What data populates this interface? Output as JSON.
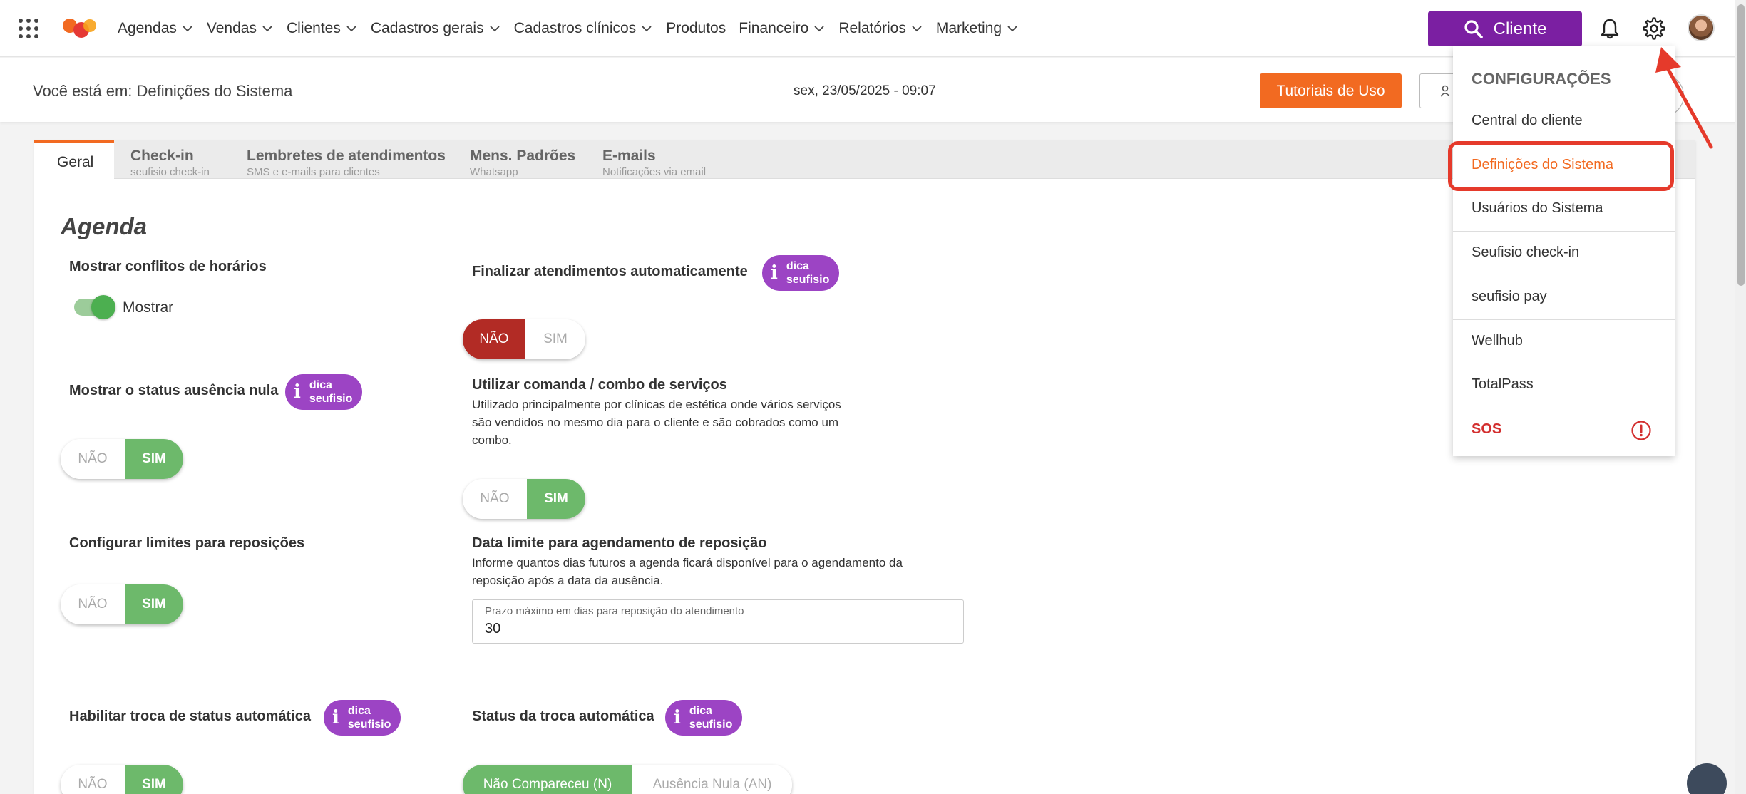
{
  "nav": {
    "items": [
      "Agendas",
      "Vendas",
      "Clientes",
      "Cadastros gerais",
      "Cadastros clínicos",
      "Produtos",
      "Financeiro",
      "Relatórios",
      "Marketing"
    ],
    "cliente_button": "Cliente"
  },
  "subheader": {
    "breadcrumb": "Você está em: Definições do Sistema",
    "datetime": "sex, 23/05/2025 - 09:07",
    "tutorial_button": "Tutoriais de Uso"
  },
  "tabs": [
    {
      "title": "Geral",
      "subtitle": ""
    },
    {
      "title": "Check-in",
      "subtitle": "seufisio check-in"
    },
    {
      "title": "Lembretes de atendimentos",
      "subtitle": "SMS e e-mails para clientes"
    },
    {
      "title": "Mens. Padrões",
      "subtitle": "Whatsapp"
    },
    {
      "title": "E-mails",
      "subtitle": "Notificações via email"
    }
  ],
  "section": {
    "title": "Agenda"
  },
  "dica": {
    "line1": "dica",
    "line2": "seufisio",
    "icon": "info-icon"
  },
  "settings": {
    "conflitos": {
      "label": "Mostrar conflitos de horários",
      "toggle_label": "Mostrar",
      "value": true
    },
    "finalizar": {
      "label": "Finalizar atendimentos automaticamente",
      "options": [
        "NÃO",
        "SIM"
      ],
      "selected": "NÃO"
    },
    "ausencia": {
      "label": "Mostrar o status ausência nula",
      "options": [
        "NÃO",
        "SIM"
      ],
      "selected": "SIM"
    },
    "comanda": {
      "label": "Utilizar comanda / combo de serviços",
      "description": "Utilizado principalmente por clínicas de estética onde vários serviços são vendidos no mesmo dia para o cliente e são cobrados como um combo.",
      "options": [
        "NÃO",
        "SIM"
      ],
      "selected": "SIM"
    },
    "limites": {
      "label": "Configurar limites para reposições",
      "options": [
        "NÃO",
        "SIM"
      ],
      "selected": "SIM"
    },
    "data_limite": {
      "label": "Data limite para agendamento de reposição",
      "description": "Informe quantos dias futuros a agenda ficará disponível para o agendamento da reposição após a data da ausência.",
      "input_label": "Prazo máximo em dias para reposição do atendimento",
      "input_value": "30"
    },
    "troca": {
      "label": "Habilitar troca de status automática",
      "options": [
        "NÃO",
        "SIM"
      ],
      "selected": "SIM"
    },
    "status_troca": {
      "label": "Status da troca automática",
      "options": [
        "Não Compareceu (N)",
        "Ausência Nula (AN)"
      ],
      "selected": "Não Compareceu (N)"
    }
  },
  "menu": {
    "header": "CONFIGURAÇÕES",
    "items": [
      "Central do cliente",
      "Definições do Sistema",
      "Usuários do Sistema",
      "Seufisio check-in",
      "seufisio pay",
      "Wellhub",
      "TotalPass",
      "SOS"
    ],
    "active": "Definições do Sistema"
  },
  "colors": {
    "brand_purple": "#7b1fa2",
    "accent_orange": "#f26a21",
    "green": "#6db96b",
    "red": "#b22b25",
    "highlight": "#e53a2b"
  }
}
